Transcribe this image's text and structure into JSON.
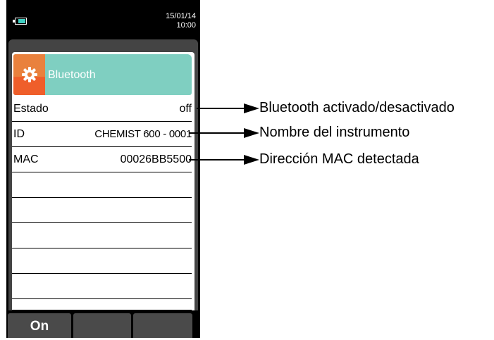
{
  "status": {
    "date": "15/01/14",
    "time": "10:00",
    "battery_icon": "battery-icon"
  },
  "header": {
    "title": "Bluetooth",
    "icon": "gear-icon",
    "icon_colors": [
      "#e9813d",
      "#ef5e2a"
    ],
    "accent": "#7fcfc1"
  },
  "rows": [
    {
      "label": "Estado",
      "value": "off"
    },
    {
      "label": "ID",
      "value": "CHEMIST 600 - 0001"
    },
    {
      "label": "MAC",
      "value": "00026BB5500"
    }
  ],
  "footer": {
    "buttons": [
      "On",
      "",
      ""
    ]
  },
  "callouts": [
    "Bluetooth activado/desactivado",
    "Nombre del instrumento",
    "Dirección MAC detectada"
  ]
}
